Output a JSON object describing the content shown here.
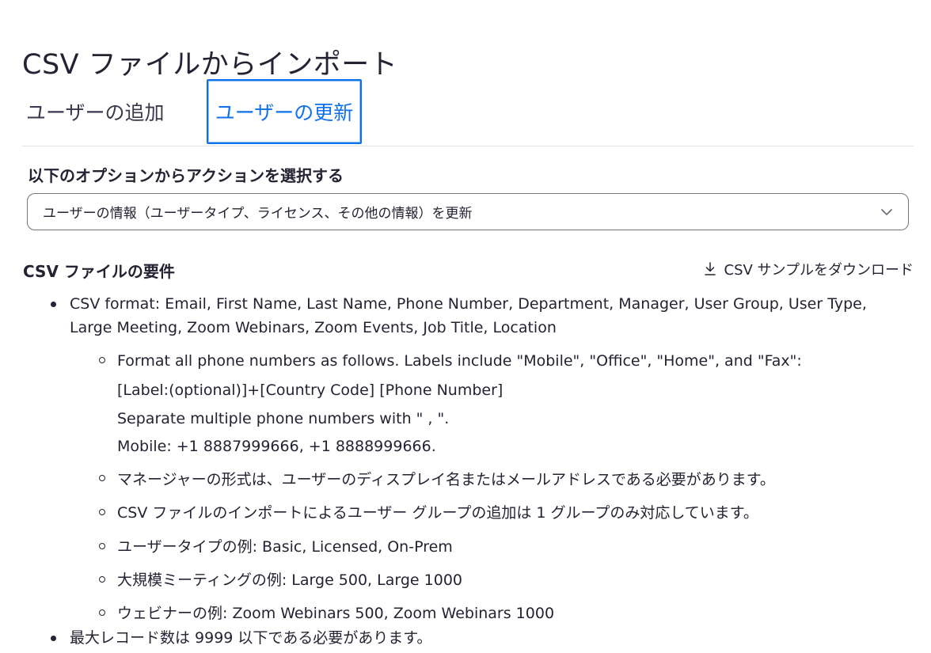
{
  "page_title": "CSV ファイルからインポート",
  "tabs": {
    "add_label": "ユーザーの追加",
    "update_label": "ユーザーの更新"
  },
  "action": {
    "label": "以下のオプションからアクションを選択する",
    "selected": "ユーザーの情報（ユーザータイプ、ライセンス、その他の情報）を更新",
    "chevron_icon": "chevron-down-icon"
  },
  "requirements": {
    "title": "CSV ファイルの要件",
    "download_label": "CSV サンプルをダウンロード",
    "download_icon": "download-icon",
    "items": [
      {
        "line1": "CSV format: Email, First Name, Last Name, Phone Number, Department, Manager, User Group, User Type,",
        "line2": "Large Meeting, Zoom Webinars, Zoom Events, Job Title, Location"
      },
      {
        "text": "最大レコード数は 9999 以下である必要があります。"
      }
    ],
    "sub_items": [
      {
        "lines": [
          "Format all phone numbers as follows. Labels include \"Mobile\", \"Office\", \"Home\", and \"Fax\":",
          "[Label:(optional)]+[Country Code] [Phone Number]",
          "Separate multiple phone numbers with \" , \".",
          "Mobile: +1 8887999666, +1 8888999666."
        ]
      },
      {
        "text": "マネージャーの形式は、ユーザーのディスプレイ名またはメールアドレスである必要があります。"
      },
      {
        "text": "CSV ファイルのインポートによるユーザー グループの追加は 1 グループのみ対応しています。"
      },
      {
        "text": "ユーザータイプの例: Basic, Licensed, On-Prem"
      },
      {
        "text": "大規模ミーティングの例: Large 500, Large 1000"
      },
      {
        "text": "ウェビナーの例: Zoom Webinars 500, Zoom Webinars 1000"
      }
    ]
  }
}
